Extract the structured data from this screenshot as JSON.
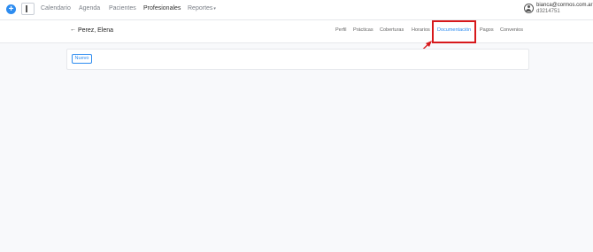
{
  "topbar": {
    "nav": {
      "calendario": "Calendario",
      "agenda": "Agenda",
      "pacientes": "Pacientes",
      "profesionales": "Profesionales",
      "reportes": "Reportes",
      "reportes_caret": "▾"
    },
    "user": {
      "email": "bianca@cormos.com.ar",
      "id": "d3214751"
    },
    "plus_glyph": "+"
  },
  "header": {
    "back_glyph": "←",
    "name": "Perez, Elena",
    "tabs": {
      "perfil": "Perfil",
      "practicas": "Prácticas",
      "coberturas": "Coberturas",
      "horarios": "Horarios",
      "documentacion": "Documentación",
      "pagos": "Pagos",
      "convenios": "Convenios"
    },
    "active_tab": "documentacion"
  },
  "content": {
    "new_button": "Nuevo"
  },
  "colors": {
    "accent": "#2d8cf0",
    "highlight": "#d7191c"
  }
}
